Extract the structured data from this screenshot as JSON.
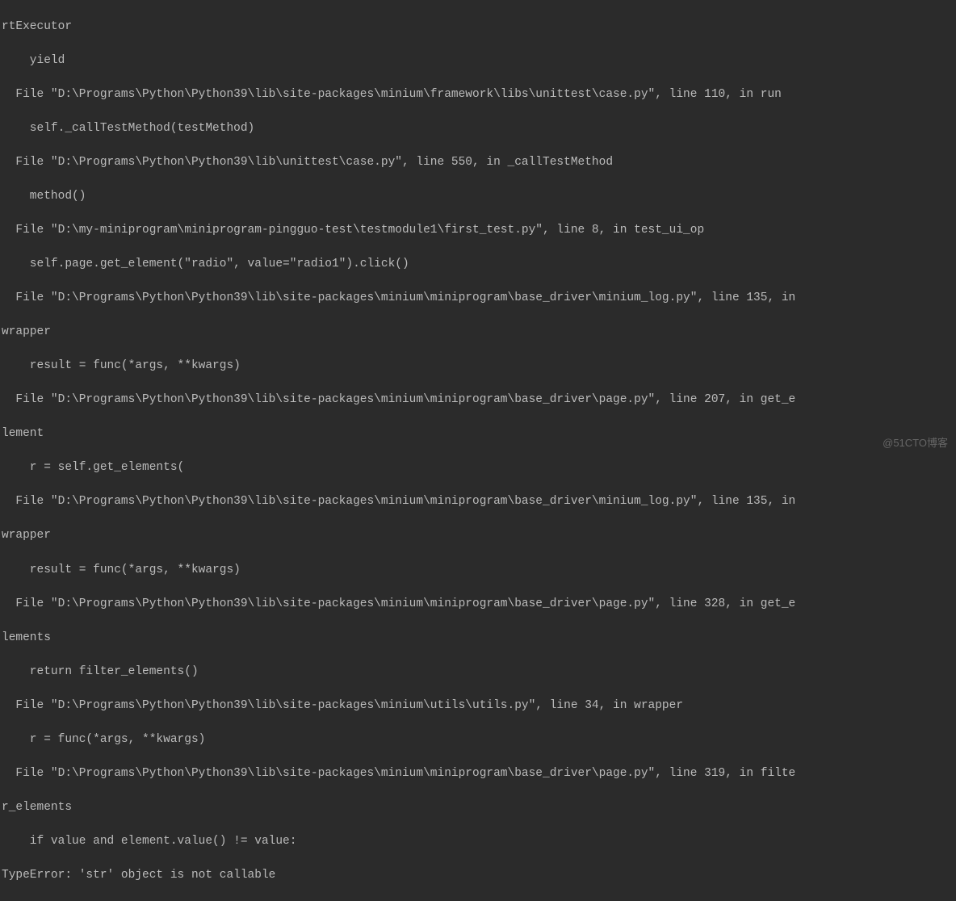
{
  "traceback": {
    "lines": [
      "rtExecutor",
      "    yield",
      "  File \"D:\\Programs\\Python\\Python39\\lib\\site-packages\\minium\\framework\\libs\\unittest\\case.py\", line 110, in run",
      "    self._callTestMethod(testMethod)",
      "  File \"D:\\Programs\\Python\\Python39\\lib\\unittest\\case.py\", line 550, in _callTestMethod",
      "    method()",
      "  File \"D:\\my-miniprogram\\miniprogram-pingguo-test\\testmodule1\\first_test.py\", line 8, in test_ui_op",
      "    self.page.get_element(\"radio\", value=\"radio1\").click()",
      "  File \"D:\\Programs\\Python\\Python39\\lib\\site-packages\\minium\\miniprogram\\base_driver\\minium_log.py\", line 135, in",
      "wrapper",
      "    result = func(*args, **kwargs)",
      "  File \"D:\\Programs\\Python\\Python39\\lib\\site-packages\\minium\\miniprogram\\base_driver\\page.py\", line 207, in get_e",
      "lement",
      "    r = self.get_elements(",
      "  File \"D:\\Programs\\Python\\Python39\\lib\\site-packages\\minium\\miniprogram\\base_driver\\minium_log.py\", line 135, in",
      "wrapper",
      "    result = func(*args, **kwargs)",
      "  File \"D:\\Programs\\Python\\Python39\\lib\\site-packages\\minium\\miniprogram\\base_driver\\page.py\", line 328, in get_e",
      "lements",
      "    return filter_elements()",
      "  File \"D:\\Programs\\Python\\Python39\\lib\\site-packages\\minium\\utils\\utils.py\", line 34, in wrapper",
      "    r = func(*args, **kwargs)",
      "  File \"D:\\Programs\\Python\\Python39\\lib\\site-packages\\minium\\miniprogram\\base_driver\\page.py\", line 319, in filte",
      "r_elements",
      "    if value and element.value() != value:",
      "TypeError: 'str' object is not callable"
    ]
  },
  "watermark": "@51CTO博客"
}
